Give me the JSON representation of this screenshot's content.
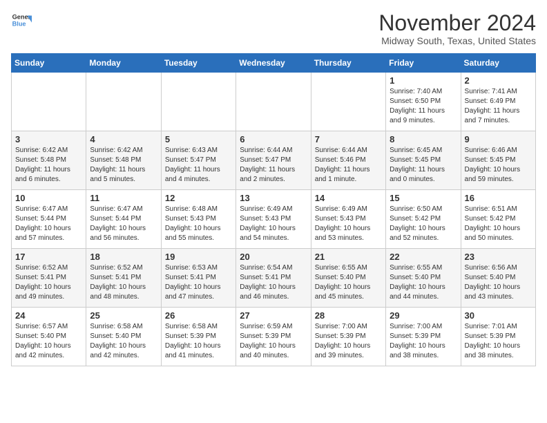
{
  "logo": {
    "general": "General",
    "blue": "Blue"
  },
  "title": "November 2024",
  "subtitle": "Midway South, Texas, United States",
  "weekdays": [
    "Sunday",
    "Monday",
    "Tuesday",
    "Wednesday",
    "Thursday",
    "Friday",
    "Saturday"
  ],
  "weeks": [
    [
      {
        "day": "",
        "info": ""
      },
      {
        "day": "",
        "info": ""
      },
      {
        "day": "",
        "info": ""
      },
      {
        "day": "",
        "info": ""
      },
      {
        "day": "",
        "info": ""
      },
      {
        "day": "1",
        "info": "Sunrise: 7:40 AM\nSunset: 6:50 PM\nDaylight: 11 hours and 9 minutes."
      },
      {
        "day": "2",
        "info": "Sunrise: 7:41 AM\nSunset: 6:49 PM\nDaylight: 11 hours and 7 minutes."
      }
    ],
    [
      {
        "day": "3",
        "info": "Sunrise: 6:42 AM\nSunset: 5:48 PM\nDaylight: 11 hours and 6 minutes."
      },
      {
        "day": "4",
        "info": "Sunrise: 6:42 AM\nSunset: 5:48 PM\nDaylight: 11 hours and 5 minutes."
      },
      {
        "day": "5",
        "info": "Sunrise: 6:43 AM\nSunset: 5:47 PM\nDaylight: 11 hours and 4 minutes."
      },
      {
        "day": "6",
        "info": "Sunrise: 6:44 AM\nSunset: 5:47 PM\nDaylight: 11 hours and 2 minutes."
      },
      {
        "day": "7",
        "info": "Sunrise: 6:44 AM\nSunset: 5:46 PM\nDaylight: 11 hours and 1 minute."
      },
      {
        "day": "8",
        "info": "Sunrise: 6:45 AM\nSunset: 5:45 PM\nDaylight: 11 hours and 0 minutes."
      },
      {
        "day": "9",
        "info": "Sunrise: 6:46 AM\nSunset: 5:45 PM\nDaylight: 10 hours and 59 minutes."
      }
    ],
    [
      {
        "day": "10",
        "info": "Sunrise: 6:47 AM\nSunset: 5:44 PM\nDaylight: 10 hours and 57 minutes."
      },
      {
        "day": "11",
        "info": "Sunrise: 6:47 AM\nSunset: 5:44 PM\nDaylight: 10 hours and 56 minutes."
      },
      {
        "day": "12",
        "info": "Sunrise: 6:48 AM\nSunset: 5:43 PM\nDaylight: 10 hours and 55 minutes."
      },
      {
        "day": "13",
        "info": "Sunrise: 6:49 AM\nSunset: 5:43 PM\nDaylight: 10 hours and 54 minutes."
      },
      {
        "day": "14",
        "info": "Sunrise: 6:49 AM\nSunset: 5:43 PM\nDaylight: 10 hours and 53 minutes."
      },
      {
        "day": "15",
        "info": "Sunrise: 6:50 AM\nSunset: 5:42 PM\nDaylight: 10 hours and 52 minutes."
      },
      {
        "day": "16",
        "info": "Sunrise: 6:51 AM\nSunset: 5:42 PM\nDaylight: 10 hours and 50 minutes."
      }
    ],
    [
      {
        "day": "17",
        "info": "Sunrise: 6:52 AM\nSunset: 5:41 PM\nDaylight: 10 hours and 49 minutes."
      },
      {
        "day": "18",
        "info": "Sunrise: 6:52 AM\nSunset: 5:41 PM\nDaylight: 10 hours and 48 minutes."
      },
      {
        "day": "19",
        "info": "Sunrise: 6:53 AM\nSunset: 5:41 PM\nDaylight: 10 hours and 47 minutes."
      },
      {
        "day": "20",
        "info": "Sunrise: 6:54 AM\nSunset: 5:41 PM\nDaylight: 10 hours and 46 minutes."
      },
      {
        "day": "21",
        "info": "Sunrise: 6:55 AM\nSunset: 5:40 PM\nDaylight: 10 hours and 45 minutes."
      },
      {
        "day": "22",
        "info": "Sunrise: 6:55 AM\nSunset: 5:40 PM\nDaylight: 10 hours and 44 minutes."
      },
      {
        "day": "23",
        "info": "Sunrise: 6:56 AM\nSunset: 5:40 PM\nDaylight: 10 hours and 43 minutes."
      }
    ],
    [
      {
        "day": "24",
        "info": "Sunrise: 6:57 AM\nSunset: 5:40 PM\nDaylight: 10 hours and 42 minutes."
      },
      {
        "day": "25",
        "info": "Sunrise: 6:58 AM\nSunset: 5:40 PM\nDaylight: 10 hours and 42 minutes."
      },
      {
        "day": "26",
        "info": "Sunrise: 6:58 AM\nSunset: 5:39 PM\nDaylight: 10 hours and 41 minutes."
      },
      {
        "day": "27",
        "info": "Sunrise: 6:59 AM\nSunset: 5:39 PM\nDaylight: 10 hours and 40 minutes."
      },
      {
        "day": "28",
        "info": "Sunrise: 7:00 AM\nSunset: 5:39 PM\nDaylight: 10 hours and 39 minutes."
      },
      {
        "day": "29",
        "info": "Sunrise: 7:00 AM\nSunset: 5:39 PM\nDaylight: 10 hours and 38 minutes."
      },
      {
        "day": "30",
        "info": "Sunrise: 7:01 AM\nSunset: 5:39 PM\nDaylight: 10 hours and 38 minutes."
      }
    ]
  ]
}
